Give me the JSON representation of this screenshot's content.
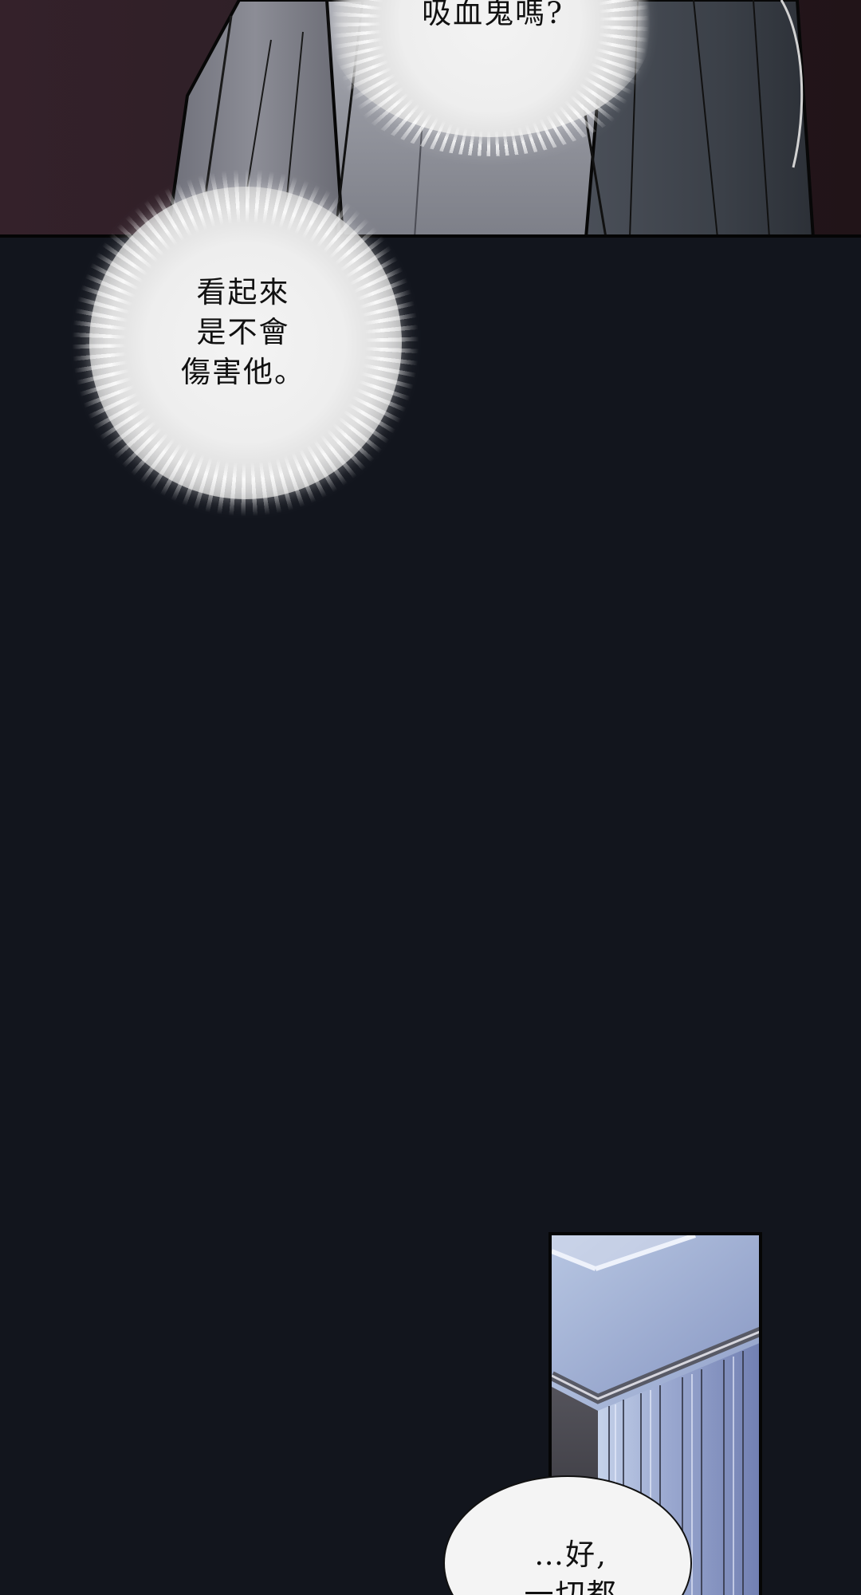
{
  "panels": {
    "top": {
      "speech": "吸血鬼嗎?"
    },
    "middle": {
      "speech": "看起來\n是不會\n傷害他。"
    },
    "bottom": {
      "speech": "…好,\n一切都"
    }
  },
  "colors": {
    "background": "#12151d",
    "top_panel": "#2d1f26",
    "bubble": "#f4f4f4",
    "text": "#111111"
  }
}
